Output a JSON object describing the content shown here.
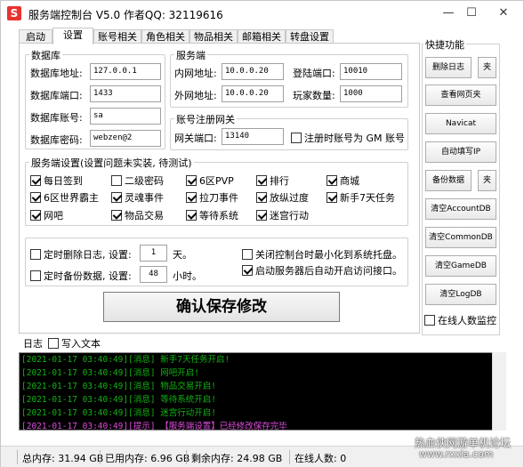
{
  "window": {
    "title": "服务端控制台 V5.0 作者QQ: 32119616",
    "icon_letter": "S",
    "minimize": "—",
    "maximize": "☐",
    "close": "✕"
  },
  "tabs": [
    "启动",
    "设置",
    "账号相关",
    "角色相关",
    "物品相关",
    "邮箱相关",
    "转盘设置"
  ],
  "active_tab": "设置",
  "database": {
    "title": "数据库",
    "address_label": "数据库地址:",
    "address_value": "127.0.0.1",
    "port_label": "数据库端口:",
    "port_value": "1433",
    "account_label": "数据库账号:",
    "account_value": "sa",
    "password_label": "数据库密码:",
    "password_value": "webzen@2"
  },
  "server": {
    "title": "服务端",
    "intranet_label": "内网地址:",
    "intranet_value": "10.0.0.20",
    "login_port_label": "登陆端口:",
    "login_port_value": "10010",
    "extranet_label": "外网地址:",
    "extranet_value": "10.0.0.20",
    "players_label": "玩家数量:",
    "players_value": "1000"
  },
  "register_gateway": {
    "title": "账号注册网关",
    "port_label": "网关端口:",
    "port_value": "13140",
    "gm_checkbox": "注册时账号为 GM 账号",
    "gm_checked": false
  },
  "server_settings": {
    "title": "服务端设置(设置问题未实装, 待测试)",
    "options": [
      {
        "label": "每日签到",
        "checked": true
      },
      {
        "label": "二级密码",
        "checked": false
      },
      {
        "label": "6区PVP",
        "checked": true
      },
      {
        "label": "排行",
        "checked": true
      },
      {
        "label": "商城",
        "checked": true
      },
      {
        "label": "6区世界霸主",
        "checked": true
      },
      {
        "label": "灵魂事件",
        "checked": true
      },
      {
        "label": "拉刀事件",
        "checked": true
      },
      {
        "label": "放纵过度",
        "checked": true
      },
      {
        "label": "新手7天任务",
        "checked": true
      },
      {
        "label": "网吧",
        "checked": true
      },
      {
        "label": "物品交易",
        "checked": true
      },
      {
        "label": "等待系统",
        "checked": true
      },
      {
        "label": "迷宫行动",
        "checked": true
      }
    ]
  },
  "timers": {
    "delete_log_label": "定时删除日志, 设置:",
    "delete_log_value": "1",
    "delete_log_unit": "天。",
    "delete_log_checked": false,
    "backup_label": "定时备份数据, 设置:",
    "backup_value": "48",
    "backup_unit": "小时。",
    "backup_checked": false,
    "minimize_tray_label": "关闭控制台时最小化到系统托盘。",
    "minimize_tray_checked": false,
    "auto_open_label": "启动服务器后自动开启访问接口。",
    "auto_open_checked": true
  },
  "save_button": "确认保存修改",
  "quick": {
    "title": "快捷功能",
    "delete_log": "删除日志",
    "folder1": "夹",
    "view_page": "查看网页夹",
    "navicat": "Navicat",
    "auto_ip": "自动填写IP",
    "backup": "备份数据",
    "folder2": "夹",
    "clear_account": "清空AccountDB",
    "clear_common": "清空CommonDB",
    "clear_game": "清空GameDB",
    "clear_log": "清空LogDB",
    "online_monitor": "在线人数监控",
    "online_monitor_checked": false
  },
  "log": {
    "title": "日志",
    "write_text": "写入文本",
    "write_text_checked": false,
    "lines": [
      {
        "text": "[2021-01-17 03:40:49][消息] 新手7天任务开启!",
        "type": "msg"
      },
      {
        "text": "[2021-01-17 03:40:49][消息] 网吧开启!",
        "type": "msg"
      },
      {
        "text": "[2021-01-17 03:40:49][消息] 物品交易开启!",
        "type": "msg"
      },
      {
        "text": "[2021-01-17 03:40:49][消息] 等待系统开启!",
        "type": "msg"
      },
      {
        "text": "[2021-01-17 03:40:49][消息] 迷宫行动开启!",
        "type": "msg"
      },
      {
        "text": "[2021-01-17 03:40:49][提示] 【服务端设置】已经修改保存完毕",
        "type": "info"
      }
    ]
  },
  "status": {
    "total_mem": "总内存: 31.94 GB",
    "used_mem": "已用内存: 6.96 GB",
    "free_mem": "剩余内存: 24.98 GB",
    "online": "在线人数: 0"
  },
  "watermark": {
    "line1": "热血侠网游单机论坛",
    "line2": "www.rxxia.com"
  }
}
